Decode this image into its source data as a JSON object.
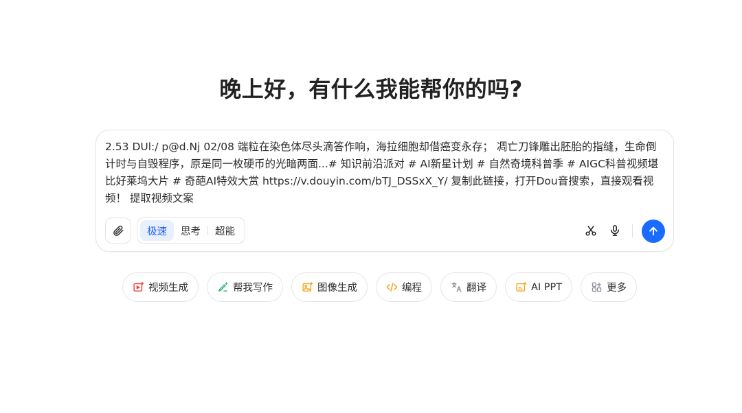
{
  "greeting": "晚上好，有什么我能帮你的吗?",
  "composer": {
    "input_text": "2.53 DUl:/ p@d.Nj 02/08 端粒在染色体尽头滴答作响，海拉细胞却借癌变永存； 凋亡刀锋雕出胚胎的指缝，生命倒计时与自毁程序，原是同一枚硬币的光暗两面...# 知识前沿派对 # AI新星计划 # 自然奇境科普季 # AIGC科普视频堪比好莱坞大片 # 奇葩AI特效大赏  https://v.douyin.com/bTJ_DSSxX_Y/ 复制此链接，打开Dou音搜索，直接观看视频！  提取视频文案",
    "modes": [
      {
        "label": "极速",
        "active": true
      },
      {
        "label": "思考",
        "active": false
      },
      {
        "label": "超能",
        "active": false
      }
    ],
    "icons": {
      "attach": "paperclip-icon",
      "scissors": "scissors-icon",
      "mic": "microphone-icon",
      "send": "arrow-up-icon"
    },
    "send_color": "#1a6bff",
    "active_mode_color": "#1f5eff"
  },
  "quick_actions": [
    {
      "label": "视频生成",
      "icon": "video-generate-icon",
      "color": "#f0423a"
    },
    {
      "label": "帮我写作",
      "icon": "pen-sparkle-icon",
      "color": "#2bb673"
    },
    {
      "label": "图像生成",
      "icon": "image-generate-icon",
      "color": "#f5a623"
    },
    {
      "label": "编程",
      "icon": "code-icon",
      "color": "#f5a623"
    },
    {
      "label": "翻译",
      "icon": "translate-icon",
      "color": "#8a8f99"
    },
    {
      "label": "AI PPT",
      "icon": "ppt-icon",
      "color": "#f5a623"
    },
    {
      "label": "更多",
      "icon": "grid-more-icon",
      "color": "#8a8f99"
    }
  ]
}
